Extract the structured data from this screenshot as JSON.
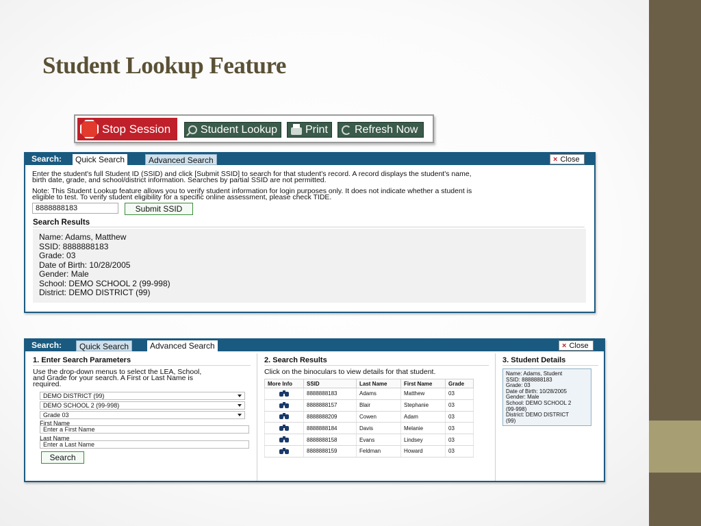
{
  "slide": {
    "title": "Student Lookup Feature"
  },
  "colors": {
    "panel_header": "#1a5a80",
    "stop_red": "#c0202a",
    "toolbar_green": "#3b5b4b",
    "side_band": "#6b6047"
  },
  "toolbar": {
    "stop_label": "Stop Session",
    "lookup_label": "Student Lookup",
    "print_label": "Print",
    "refresh_label": "Refresh Now"
  },
  "quick": {
    "search_label": "Search:",
    "tab_quick": "Quick Search",
    "tab_advanced": "Advanced Search",
    "close_label": "Close",
    "instructions_line1": "Enter the student's full Student ID (SSID) and click [Submit SSID] to search for that student's record. A record displays the student's name,",
    "instructions_line2": "birth date, grade, and school/district information. Searches by partial SSID are not permitted.",
    "note_line1": "Note: This Student Lookup feature allows you to verify student information for login purposes only. It does not indicate whether a student is",
    "note_line2": "eligible to test. To verify student eligibility for a specific online assessment, please check TIDE.",
    "ssid_value": "8888888183",
    "submit_label": "Submit SSID",
    "results_title": "Search Results",
    "record": {
      "name": "Name: Adams, Matthew",
      "ssid": "SSID: 8888888183",
      "grade": "Grade: 03",
      "dob": "Date of Birth: 10/28/2005",
      "gender": "Gender: Male",
      "school": "School: DEMO SCHOOL 2 (99-998)",
      "district": "District: DEMO DISTRICT (99)"
    }
  },
  "advanced": {
    "search_label": "Search:",
    "tab_quick": "Quick Search",
    "tab_advanced": "Advanced Search",
    "close_label": "Close",
    "params_title": "1. Enter Search Parameters",
    "params_desc_line1": "Use the drop-down menus to select the LEA, School,",
    "params_desc_line2": "and Grade for your search. A First or Last Name is",
    "params_desc_line3": "required.",
    "district_select": "DEMO DISTRICT (99)",
    "school_select": "DEMO SCHOOL 2 (99-998)",
    "grade_select": "Grade 03",
    "first_name_label": "First Name",
    "first_name_placeholder": "Enter a First Name",
    "last_name_label": "Last Name",
    "last_name_placeholder": "Enter a Last Name",
    "search_button": "Search",
    "results_title": "2. Search Results",
    "results_desc": "Click on the binoculars to view details for that student.",
    "columns": [
      "More Info",
      "SSID",
      "Last Name",
      "First Name",
      "Grade"
    ],
    "rows": [
      {
        "ssid": "8888888183",
        "last": "Adams",
        "first": "Matthew",
        "grade": "03"
      },
      {
        "ssid": "8888888157",
        "last": "Blair",
        "first": "Stephanie",
        "grade": "03"
      },
      {
        "ssid": "8888888209",
        "last": "Cowen",
        "first": "Adam",
        "grade": "03"
      },
      {
        "ssid": "8888888184",
        "last": "Davis",
        "first": "Melanie",
        "grade": "03"
      },
      {
        "ssid": "8888888158",
        "last": "Evans",
        "first": "Lindsey",
        "grade": "03"
      },
      {
        "ssid": "8888888159",
        "last": "Feldman",
        "first": "Howard",
        "grade": "03"
      }
    ],
    "details_title": "3. Student Details",
    "details": {
      "name": "Name: Adams, Student",
      "ssid": "SSID: 8888888183",
      "grade": "Grade: 03",
      "dob": "Date of Birth: 10/28/2005",
      "gender": "Gender: Male",
      "school_line1": "School: DEMO SCHOOL 2",
      "school_line2": "(99-998)",
      "district_line1": "District: DEMO DISTRICT",
      "district_line2": "(99)"
    }
  }
}
